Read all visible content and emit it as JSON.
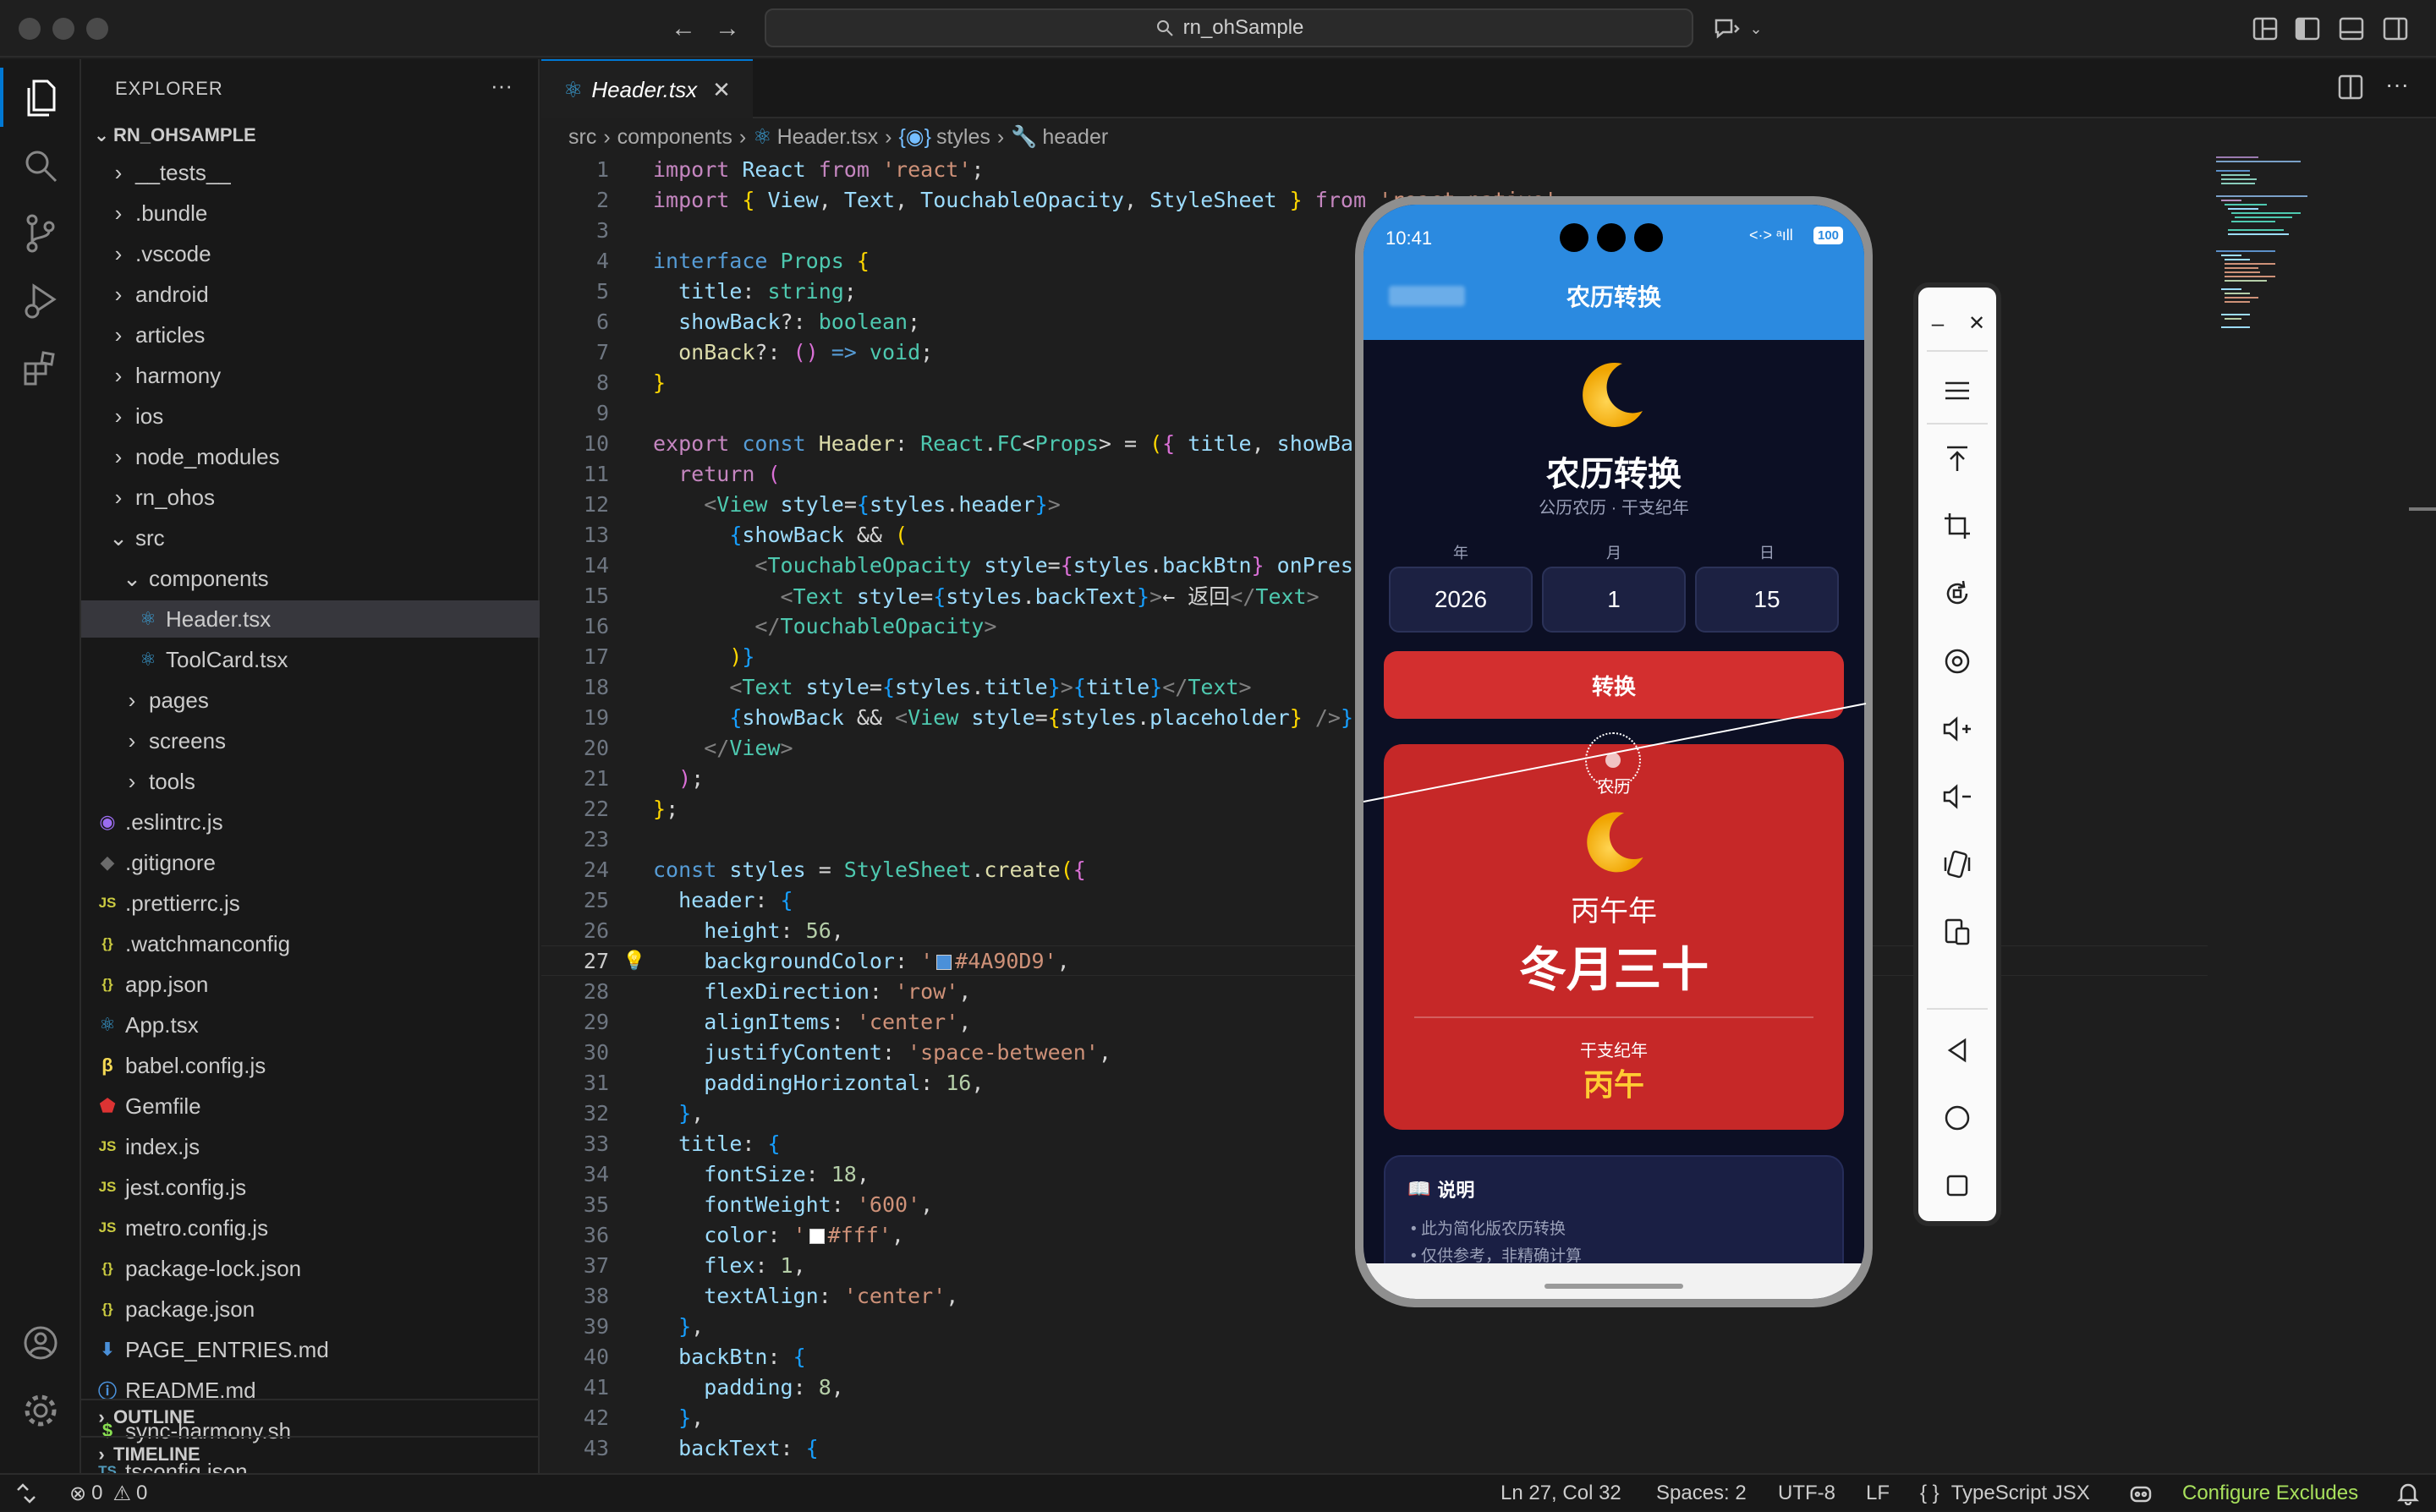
{
  "window": {
    "search_text": "rn_ohSample"
  },
  "explorer": {
    "title": "EXPLORER",
    "root": "RN_OHSAMPLE",
    "items": [
      {
        "label": "__tests__",
        "type": "folder"
      },
      {
        "label": ".bundle",
        "type": "folder"
      },
      {
        "label": ".vscode",
        "type": "folder"
      },
      {
        "label": "android",
        "type": "folder"
      },
      {
        "label": "articles",
        "type": "folder"
      },
      {
        "label": "harmony",
        "type": "folder"
      },
      {
        "label": "ios",
        "type": "folder"
      },
      {
        "label": "node_modules",
        "type": "folder"
      },
      {
        "label": "rn_ohos",
        "type": "folder"
      },
      {
        "label": "src",
        "type": "folder-open"
      },
      {
        "label": "components",
        "type": "folder-open"
      },
      {
        "label": "Header.tsx",
        "type": "react"
      },
      {
        "label": "ToolCard.tsx",
        "type": "react"
      },
      {
        "label": "pages",
        "type": "folder"
      },
      {
        "label": "screens",
        "type": "folder"
      },
      {
        "label": "tools",
        "type": "folder"
      },
      {
        "label": ".eslintrc.js",
        "type": "eslint"
      },
      {
        "label": ".gitignore",
        "type": "git"
      },
      {
        "label": ".prettierrc.js",
        "type": "js"
      },
      {
        "label": ".watchmanconfig",
        "type": "json"
      },
      {
        "label": "app.json",
        "type": "json"
      },
      {
        "label": "App.tsx",
        "type": "react"
      },
      {
        "label": "babel.config.js",
        "type": "babel"
      },
      {
        "label": "Gemfile",
        "type": "ruby"
      },
      {
        "label": "index.js",
        "type": "js"
      },
      {
        "label": "jest.config.js",
        "type": "js"
      },
      {
        "label": "metro.config.js",
        "type": "js"
      },
      {
        "label": "package-lock.json",
        "type": "json"
      },
      {
        "label": "package.json",
        "type": "json"
      },
      {
        "label": "PAGE_ENTRIES.md",
        "type": "md"
      },
      {
        "label": "README.md",
        "type": "info"
      },
      {
        "label": "sync-harmony.sh",
        "type": "sh"
      },
      {
        "label": "tsconfig.json",
        "type": "ts"
      }
    ],
    "outline": "OUTLINE",
    "timeline": "TIMELINE"
  },
  "editor": {
    "tab": "Header.tsx",
    "breadcrumb": [
      "src",
      "components",
      "Header.tsx",
      "styles",
      "header"
    ],
    "current_line": 27
  },
  "colors": {
    "accent": "#0078d4",
    "swatch_blue": "#4A90D9",
    "swatch_white": "#ffffff"
  },
  "statusbar": {
    "errors": "0",
    "warnings": "0",
    "position": "Ln 27, Col 32",
    "spaces": "Spaces: 2",
    "encoding": "UTF-8",
    "eol": "LF",
    "language": "TypeScript JSX",
    "configure": "Configure Excludes"
  },
  "phone": {
    "time": "10:41",
    "battery": "100",
    "header_title": "农历转换",
    "hero_title": "农历转换",
    "hero_sub": "公历农历 · 干支纪年",
    "labels": [
      "年",
      "月",
      "日"
    ],
    "values": [
      "2026",
      "1",
      "15"
    ],
    "convert_btn": "转换",
    "result_tag": "农历",
    "result_year": "丙午年",
    "result_date": "冬月三十",
    "ganzhi_label": "干支纪年",
    "ganzhi_value": "丙午",
    "info_title": "说明",
    "info_items": [
      "此为简化版农历转换",
      "仅供参考，非精确计算"
    ]
  }
}
